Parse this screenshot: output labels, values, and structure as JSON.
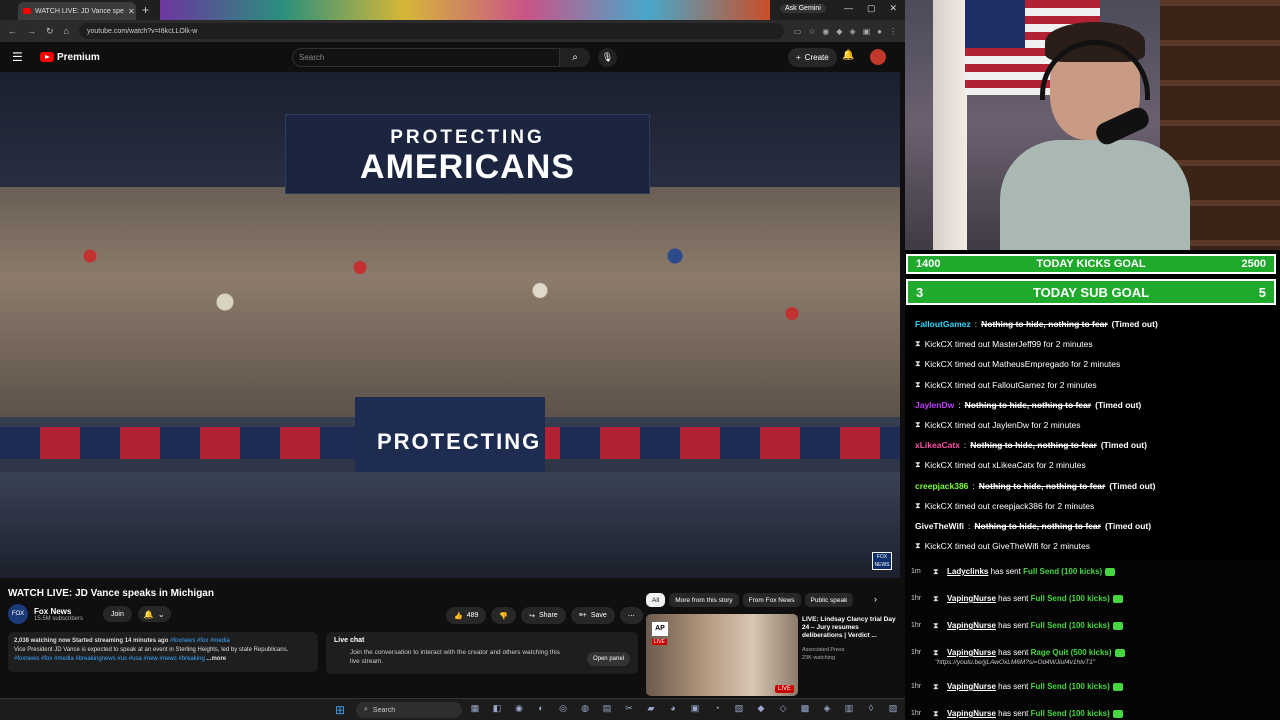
{
  "browser": {
    "tab_title": "WATCH LIVE: JD Vance spe",
    "ask_gemini": "Ask Gemini",
    "url": "youtube.com/watch?v=I8kcLLOlk-w",
    "window_controls": [
      "—",
      "▢",
      "✕"
    ]
  },
  "youtube": {
    "logo_text": "Premium",
    "search_placeholder": "Search",
    "create_label": "Create",
    "video": {
      "banner_line1": "PROTECTING",
      "banner_line2": "AMERICANS",
      "lower_banner": "PROTECTING",
      "bug": "FOX NEWS"
    },
    "title": "WATCH LIVE: JD Vance speaks in Michigan",
    "channel": {
      "name": "Fox News",
      "subscribers": "15.5M subscribers",
      "join_label": "Join"
    },
    "actions": {
      "likes": "489",
      "share": "Share",
      "save": "Save"
    },
    "description": {
      "meta": "2,038 watching now  Started streaming 14 minutes ago",
      "meta_tags": "#foxnews #fox #media",
      "text": "Vice President JD Vance is expected to speak at an event in Sterling Heights, led by state Republicans.",
      "tags": "#foxnews #fox #media #breakingnews #us #usa #new #news #breaking",
      "more": "...more"
    },
    "live_chat": {
      "header": "Live chat",
      "body": "Join the conversation to interact with the creator and others watching this live stream.",
      "button": "Open panel"
    },
    "chips": [
      "All",
      "More from this story",
      "From Fox News",
      "Public speak"
    ],
    "recommended": {
      "title": "LIVE: Lindsay Clancy trial Day 24 – Jury resumes deliberations | Verdict ...",
      "channel": "Associated Press",
      "watching": "23K watching",
      "badge": "LIVE",
      "ap": "AP"
    }
  },
  "taskbar": {
    "search_label": "Search"
  },
  "goals": {
    "kicks": {
      "current": "1400",
      "label": "TODAY KICKS GOAL",
      "target": "2500"
    },
    "subs": {
      "current": "3",
      "label": "TODAY SUB GOAL",
      "target": "5"
    }
  },
  "chat": [
    {
      "type": "msg",
      "user": "FalloutGamez",
      "color": "#2fd7ff",
      "text": "Nothing to hide, nothing to fear",
      "tag": "(Timed out)"
    },
    {
      "type": "sys",
      "text": "KickCX timed out MasterJeff99 for 2 minutes"
    },
    {
      "type": "sys",
      "text": "KickCX timed out MatheusEmpregado for 2 minutes"
    },
    {
      "type": "sys",
      "text": "KickCX timed out FalloutGamez for 2 minutes"
    },
    {
      "type": "msg",
      "user": "JaylenDw",
      "color": "#c040ff",
      "text": "Nothing to hide, nothing to fear",
      "tag": "(Timed out)"
    },
    {
      "type": "sys",
      "text": "KickCX timed out JaylenDw for 2 minutes"
    },
    {
      "type": "msg",
      "user": "xLikeaCatx",
      "color": "#ff4fa8",
      "text": "Nothing to hide, nothing to fear",
      "tag": "(Timed out)"
    },
    {
      "type": "sys",
      "text": "KickCX timed out xLikeaCatx for 2 minutes"
    },
    {
      "type": "msg",
      "user": "creepjack386",
      "color": "#7cff3a",
      "text": "Nothing to hide, nothing to fear",
      "tag": "(Timed out)"
    },
    {
      "type": "sys",
      "text": "KickCX timed out creepjack386 for 2 minutes"
    },
    {
      "type": "msg",
      "user": "GiveTheWifi",
      "color": "#ffffff",
      "text": "Nothing to hide, nothing to fear",
      "tag": "(Timed out)"
    },
    {
      "type": "sys",
      "text": "KickCX timed out GiveTheWifi for 2 minutes"
    }
  ],
  "events": [
    {
      "time": "1m",
      "user": "Ladyclinks",
      "text": "has sent",
      "gift": "Full Send (100 kicks)"
    },
    {
      "time": "1hr",
      "user": "VapingNurse",
      "text": "has sent",
      "gift": "Full Send (100 kicks)"
    },
    {
      "time": "1hr",
      "user": "VapingNurse",
      "text": "has sent",
      "gift": "Full Send (100 kicks)"
    },
    {
      "time": "1hr",
      "user": "VapingNurse",
      "text": "has sent",
      "gift": "Rage Quit (500 kicks)",
      "sub": "\"https://youtu.be/jjLAwOxLM6M?si=Od4WJiuf4v1hIvT1\""
    },
    {
      "time": "1hr",
      "user": "VapingNurse",
      "text": "has sent",
      "gift": "Full Send (100 kicks)"
    },
    {
      "time": "1hr",
      "user": "VapingNurse",
      "text": "has sent",
      "gift": "Full Send (100 kicks)"
    }
  ]
}
